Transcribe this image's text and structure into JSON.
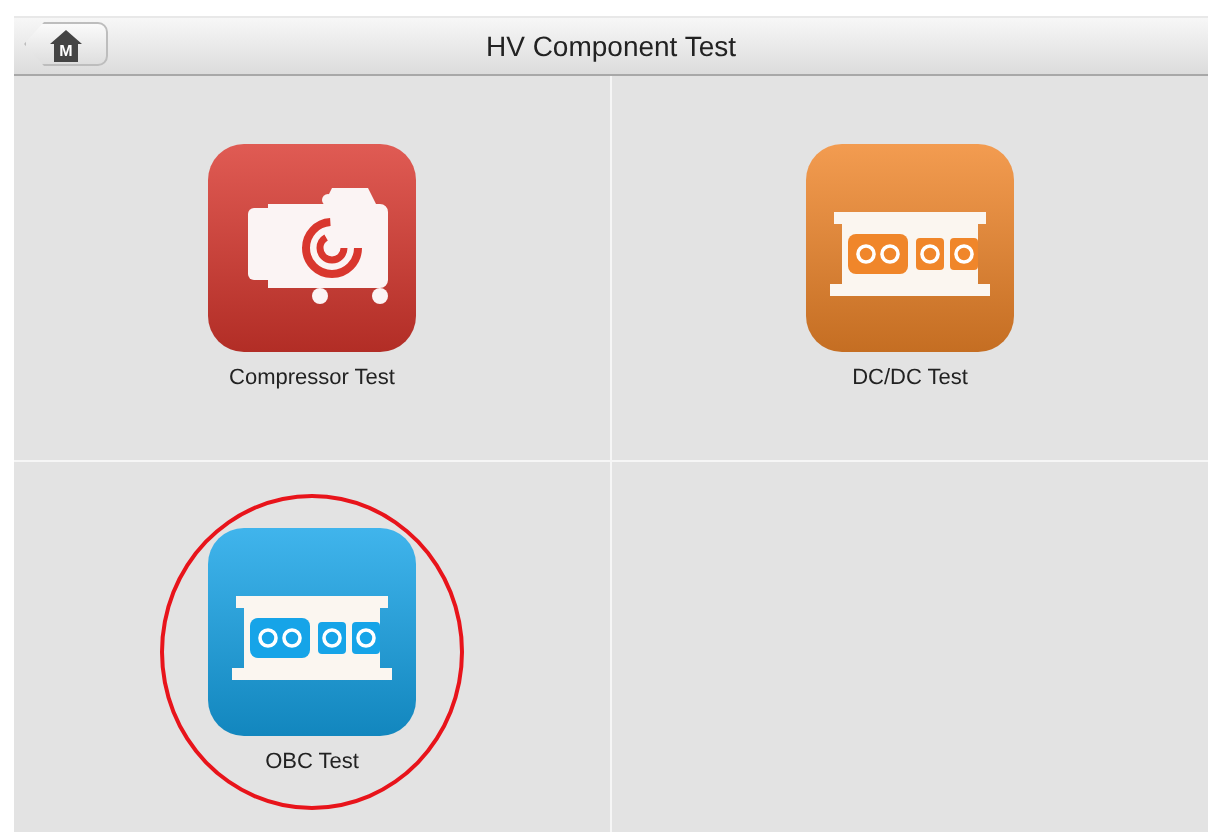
{
  "header": {
    "home_button": "M",
    "title": "HV Component Test"
  },
  "tiles": [
    {
      "label": "Compressor Test",
      "kind": "compressor",
      "color": "#d9372e",
      "highlighted": false
    },
    {
      "label": "DC/DC Test",
      "kind": "converter",
      "color": "#f0862a",
      "highlighted": false
    },
    {
      "label": "OBC Test",
      "kind": "converter",
      "color": "#16a4e8",
      "highlighted": true
    }
  ]
}
